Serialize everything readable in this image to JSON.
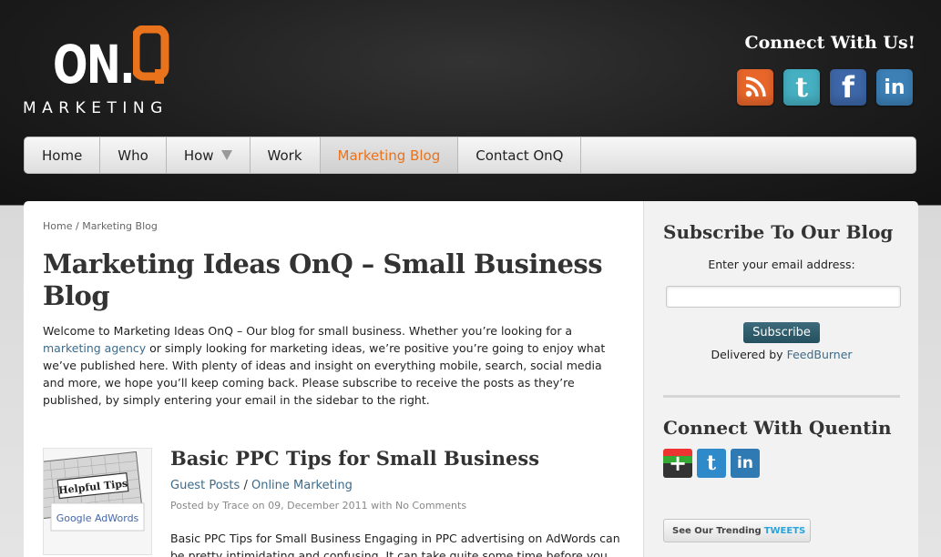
{
  "header": {
    "logo_main": "ON.",
    "logo_q": "Q",
    "logo_sub": "MARKETING",
    "connect_title": "Connect With Us!",
    "social": [
      {
        "name": "rss-icon",
        "glyph": "",
        "color": "#e8662a"
      },
      {
        "name": "twitter-icon",
        "glyph": "t",
        "color": "#45b0c2"
      },
      {
        "name": "facebook-icon",
        "glyph": "f",
        "color": "#3d67a8"
      },
      {
        "name": "linkedin-icon",
        "glyph": "in",
        "color": "#3c80b6"
      }
    ]
  },
  "nav": {
    "items": [
      "Home",
      "Who",
      "How",
      "Work",
      "Marketing Blog",
      "Contact OnQ"
    ],
    "active_index": 4
  },
  "main": {
    "breadcrumb": {
      "home": "Home",
      "separator": "/",
      "current": "Marketing Blog"
    },
    "title": "Marketing Ideas OnQ – Small Business Blog",
    "intro_before_link": "Welcome to Marketing Ideas OnQ – Our blog for small business. Whether you’re looking for a ",
    "intro_link": "marketing agency",
    "intro_after_link": " or simply looking for marketing ideas, we’re positive you’re going to enjoy what we’ve published here. With plenty of ideas and insight on everything mobile, search, social media and more, we hope you’ll keep coming back. Please subscribe to receive the posts as they’re published, by simply entering your email in the sidebar to the right.",
    "post": {
      "thumb_text_1": "Helpful Tips",
      "thumb_text_2": "Google AdWords",
      "title": "Basic PPC Tips for Small Business",
      "cat1": "Guest Posts",
      "cat_sep": "/",
      "cat2": "Online Marketing",
      "meta": "Posted by Trace on 09, December 2011 with No Comments",
      "excerpt": "Basic PPC Tips for Small Business Engaging in PPC advertising on AdWords can be pretty intimidating and confusing. It can take quite some time before you"
    }
  },
  "sidebar": {
    "subscribe_title": "Subscribe To Our Blog",
    "email_label": "Enter your email address:",
    "email_value": "",
    "subscribe_button": "Subscribe",
    "delivered_by": "Delivered by ",
    "feedburner": "FeedBurner",
    "connect_title": "Connect With Quentin",
    "quentin_icons": [
      {
        "name": "google-plus-icon",
        "glyph": "+",
        "color": "#333333"
      },
      {
        "name": "twitter-icon",
        "glyph": "t",
        "color": "#2f8ac9"
      },
      {
        "name": "linkedin-icon",
        "glyph": "in",
        "color": "#2f7ab3"
      }
    ],
    "tweets_prefix": "See Our Trending",
    "tweets_word": "TWEETS"
  },
  "colors": {
    "accent": "#e8731c",
    "link": "#3d6b8a",
    "button": "#2d5a6a"
  }
}
